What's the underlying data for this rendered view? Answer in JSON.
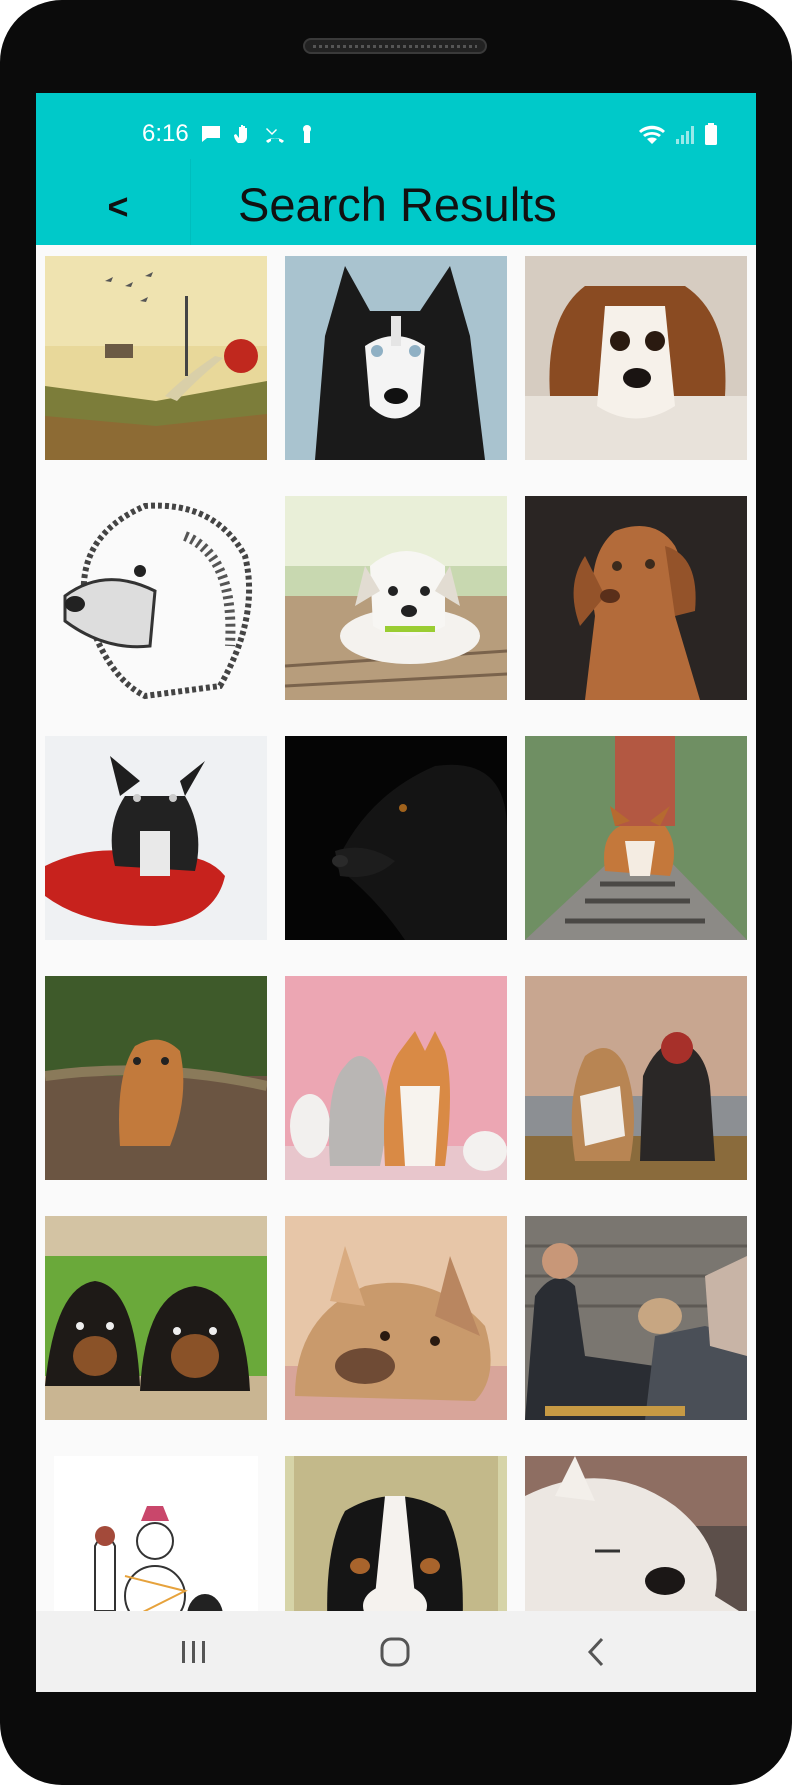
{
  "status_bar": {
    "time": "6:16",
    "left_icons": [
      "message-icon",
      "hand-icon",
      "missed-call-icon",
      "keyhole-icon"
    ],
    "right_icons": [
      "wifi-icon",
      "signal-icon",
      "battery-icon"
    ]
  },
  "app_bar": {
    "back_label": "<",
    "title": "Search Results",
    "color": "#00c9c9"
  },
  "results": [
    {
      "name": "result-book-dog-illustration"
    },
    {
      "name": "result-husky"
    },
    {
      "name": "result-cavalier-spaniel"
    },
    {
      "name": "result-dog-sketch"
    },
    {
      "name": "result-white-puppy"
    },
    {
      "name": "result-vizsla"
    },
    {
      "name": "result-french-bulldog-pillow"
    },
    {
      "name": "result-black-dog"
    },
    {
      "name": "result-corgi-tracks"
    },
    {
      "name": "result-running-poodle"
    },
    {
      "name": "result-poodle-corgi-cats"
    },
    {
      "name": "result-bulldog-and-woman"
    },
    {
      "name": "result-rottweiler-puppies"
    },
    {
      "name": "result-french-bulldog-lying"
    },
    {
      "name": "result-couple-with-pug"
    },
    {
      "name": "result-snowman-drawing"
    },
    {
      "name": "result-bernese-mountain-dog"
    },
    {
      "name": "result-samoyed"
    }
  ],
  "nav_bar": {
    "buttons": [
      "recents-icon",
      "home-icon",
      "back-icon"
    ]
  }
}
